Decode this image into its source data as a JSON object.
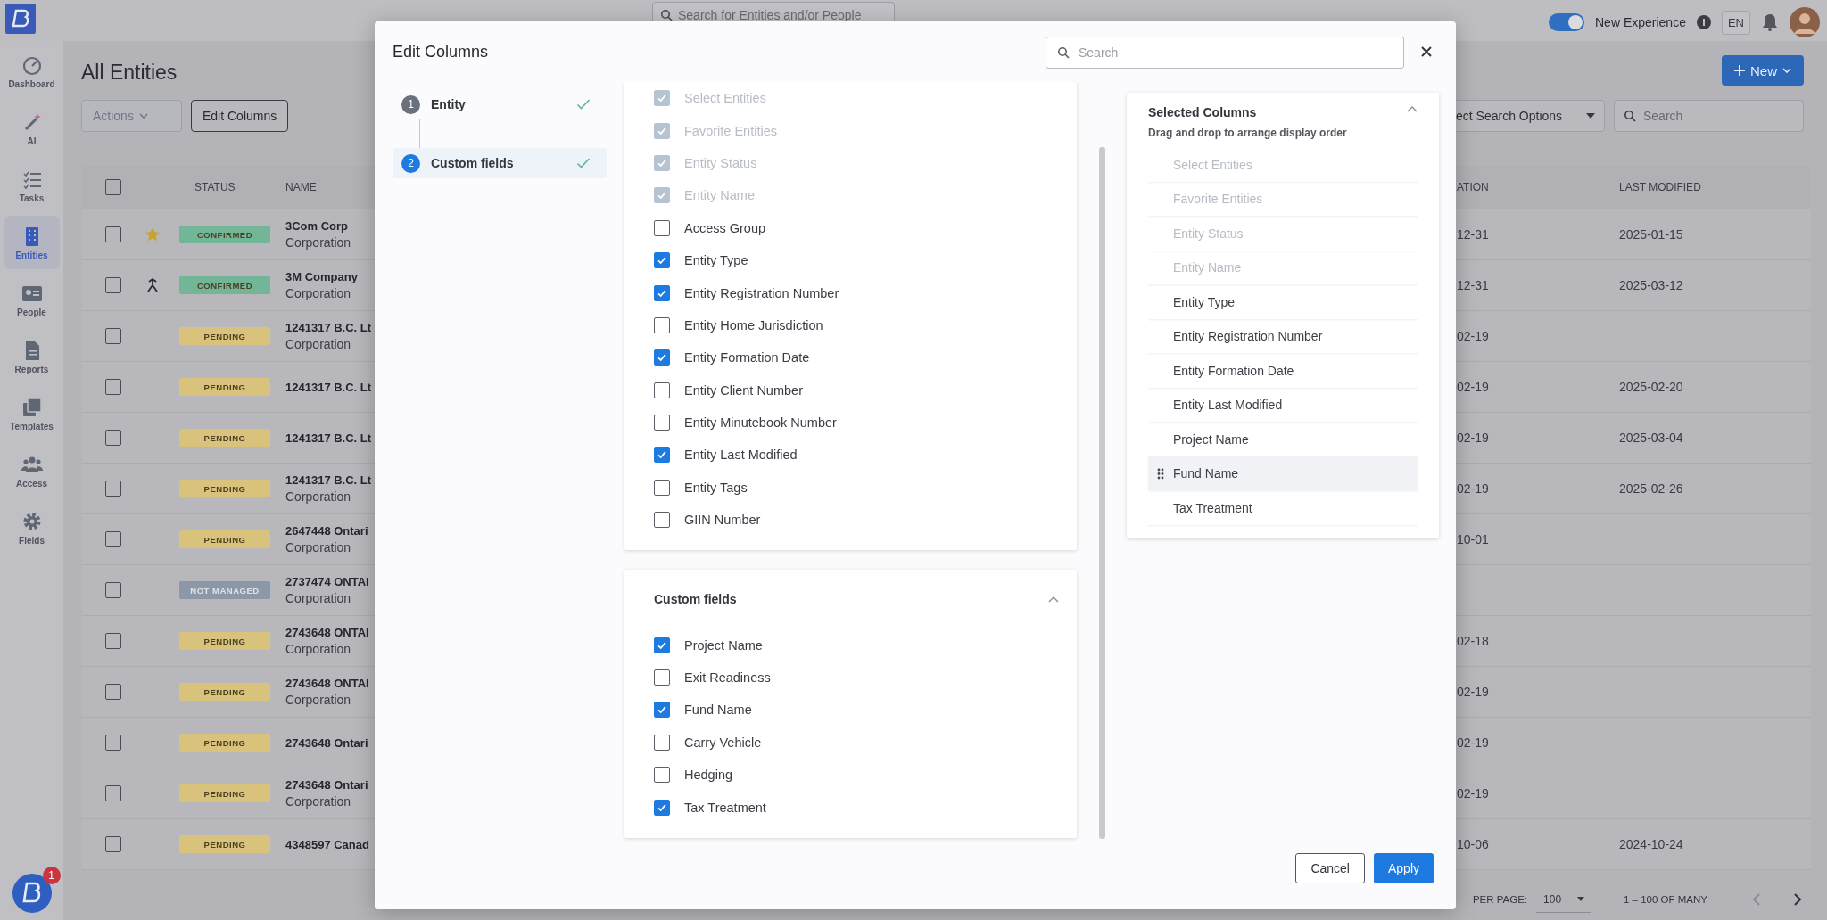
{
  "top_bar": {
    "search_placeholder": "Search for Entities and/or People",
    "toggle": {
      "label": "New Experience",
      "on": true
    },
    "language": "EN"
  },
  "sidebar": {
    "items": [
      {
        "label": "Dashboard",
        "selected": false
      },
      {
        "label": "AI",
        "selected": false
      },
      {
        "label": "Tasks",
        "selected": false
      },
      {
        "label": "Entities",
        "selected": true
      },
      {
        "label": "People",
        "selected": false
      },
      {
        "label": "Reports",
        "selected": false
      },
      {
        "label": "Templates",
        "selected": false
      },
      {
        "label": "Access",
        "selected": false
      },
      {
        "label": "Fields",
        "selected": false
      }
    ],
    "help_badge": "1"
  },
  "page": {
    "title": "All Entities",
    "actions": {
      "label": "Actions",
      "disabled": true
    },
    "edit_columns": "Edit Columns",
    "new_button": "New",
    "search_options": "ect Search Options",
    "search_placeholder": "Search"
  },
  "table": {
    "select_all_checked": false,
    "columns": [
      "STATUS",
      "NAME",
      "ATION",
      "LAST MODIFIED"
    ],
    "rows": [
      {
        "checked": false,
        "kind": "starred",
        "status": {
          "label": "CONFIRMED",
          "color": "#72b597"
        },
        "name": "3Com Corp",
        "type": "Corporation",
        "column_5": "12-31",
        "last_modified": "2025-01-15"
      },
      {
        "checked": false,
        "kind": "merged",
        "status": {
          "label": "CONFIRMED",
          "color": "#72b597"
        },
        "name": "3M Company",
        "type": "Corporation",
        "column_5": "12-31",
        "last_modified": "2025-03-12"
      },
      {
        "checked": false,
        "status": {
          "label": "PENDING",
          "color": "#d8c27c"
        },
        "name": "1241317 B.C. Lt",
        "type": "Corporation",
        "column_5": "02-19"
      },
      {
        "checked": false,
        "status": {
          "label": "PENDING",
          "color": "#d8c27c"
        },
        "name": "1241317 B.C. Lt",
        "column_5": "02-19",
        "last_modified": "2025-02-20"
      },
      {
        "checked": false,
        "status": {
          "label": "PENDING",
          "color": "#d8c27c"
        },
        "name": "1241317 B.C. Lt",
        "column_5": "02-19",
        "last_modified": "2025-03-04"
      },
      {
        "checked": false,
        "status": {
          "label": "PENDING",
          "color": "#d8c27c"
        },
        "name": "1241317 B.C. Lt",
        "type": "Corporation",
        "column_5": "02-19",
        "last_modified": "2025-02-26"
      },
      {
        "checked": false,
        "status": {
          "label": "PENDING",
          "color": "#d8c27c"
        },
        "name": "2647448 Ontari",
        "type": "Corporation",
        "column_5": "10-01"
      },
      {
        "checked": false,
        "status": {
          "label": "NOT MANAGED",
          "color": "#8c97a8"
        },
        "name": "2737474 ONTAI",
        "type": "Corporation"
      },
      {
        "checked": false,
        "status": {
          "label": "PENDING",
          "color": "#d8c27c"
        },
        "name": "2743648 ONTAI",
        "type": "Corporation",
        "column_5": "02-18"
      },
      {
        "checked": false,
        "status": {
          "label": "PENDING",
          "color": "#d8c27c"
        },
        "name": "2743648 ONTAI",
        "type": "Corporation",
        "column_5": "02-19"
      },
      {
        "checked": false,
        "status": {
          "label": "PENDING",
          "color": "#d8c27c"
        },
        "name": "2743648 Ontari",
        "column_5": "02-19"
      },
      {
        "checked": false,
        "status": {
          "label": "PENDING",
          "color": "#d8c27c"
        },
        "name": "2743648 Ontari",
        "type": "Corporation",
        "column_5": "02-19"
      },
      {
        "checked": false,
        "status": {
          "label": "PENDING",
          "color": "#d8c27c"
        },
        "name": "4348597 Canad",
        "column_5": "10-06",
        "last_modified": "2024-10-24"
      }
    ]
  },
  "pagination": {
    "per_page_label": "PER PAGE:",
    "per_page": "100",
    "range": "1 – 100 OF MANY"
  },
  "dialog": {
    "title": "Edit Columns",
    "search_placeholder": "Search",
    "steps": [
      {
        "number": "1",
        "label": "Entity",
        "selected": false,
        "completed": true
      },
      {
        "number": "2",
        "label": "Custom fields",
        "selected": true,
        "completed": true
      }
    ],
    "entity_fields": [
      {
        "label": "Select Entities",
        "checked": true,
        "disabled": true
      },
      {
        "label": "Favorite Entities",
        "checked": true,
        "disabled": true
      },
      {
        "label": "Entity Status",
        "checked": true,
        "disabled": true
      },
      {
        "label": "Entity Name",
        "checked": true,
        "disabled": true
      },
      {
        "label": "Access Group",
        "checked": false,
        "disabled": false
      },
      {
        "label": "Entity Type",
        "checked": true,
        "disabled": false
      },
      {
        "label": "Entity Registration Number",
        "checked": true,
        "disabled": false
      },
      {
        "label": "Entity Home Jurisdiction",
        "checked": false,
        "disabled": false
      },
      {
        "label": "Entity Formation Date",
        "checked": true,
        "disabled": false
      },
      {
        "label": "Entity Client Number",
        "checked": false,
        "disabled": false
      },
      {
        "label": "Entity Minutebook Number",
        "checked": false,
        "disabled": false
      },
      {
        "label": "Entity Last Modified",
        "checked": true,
        "disabled": false
      },
      {
        "label": "Entity Tags",
        "checked": false,
        "disabled": false
      },
      {
        "label": "GIIN Number",
        "checked": false,
        "disabled": false
      }
    ],
    "custom_fields": {
      "title": "Custom fields",
      "expanded": true,
      "items": [
        {
          "label": "Project Name",
          "checked": true
        },
        {
          "label": "Exit Readiness",
          "checked": false
        },
        {
          "label": "Fund Name",
          "checked": true
        },
        {
          "label": "Carry Vehicle",
          "checked": false
        },
        {
          "label": "Hedging",
          "checked": false
        },
        {
          "label": "Tax Treatment",
          "checked": true
        }
      ]
    },
    "selected_columns": {
      "title": "Selected Columns",
      "subtitle": "Drag and drop to arrange display order",
      "expanded": true,
      "items": [
        {
          "label": "Select Entities",
          "disabled": true,
          "hovered": false
        },
        {
          "label": "Favorite Entities",
          "disabled": true,
          "hovered": false
        },
        {
          "label": "Entity Status",
          "disabled": true,
          "hovered": false
        },
        {
          "label": "Entity Name",
          "disabled": true,
          "hovered": false
        },
        {
          "label": "Entity Type",
          "disabled": false,
          "hovered": false
        },
        {
          "label": "Entity Registration Number",
          "disabled": false,
          "hovered": false
        },
        {
          "label": "Entity Formation Date",
          "disabled": false,
          "hovered": false
        },
        {
          "label": "Entity Last Modified",
          "disabled": false,
          "hovered": false
        },
        {
          "label": "Project Name",
          "disabled": false,
          "hovered": false
        },
        {
          "label": "Fund Name",
          "disabled": false,
          "hovered": true
        },
        {
          "label": "Tax Treatment",
          "disabled": false,
          "hovered": false
        }
      ]
    },
    "buttons": {
      "cancel": "Cancel",
      "apply": "Apply"
    }
  }
}
